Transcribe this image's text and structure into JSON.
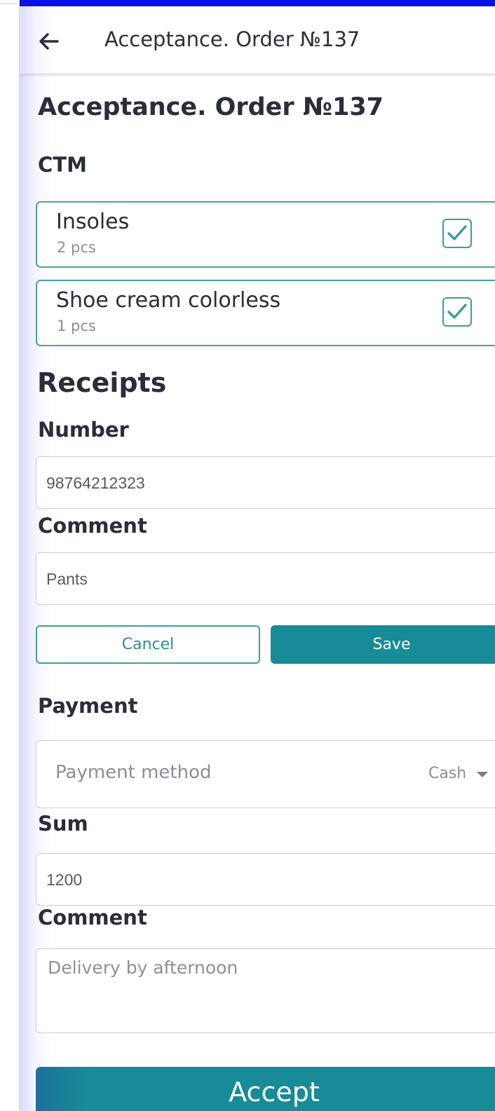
{
  "app_bar": {
    "title": "Acceptance. Order №137"
  },
  "page": {
    "title": "Acceptance. Order №137"
  },
  "ctm": {
    "section_title": "CTM",
    "items": [
      {
        "name": "Insoles",
        "quantity": "2 pcs",
        "checked": true
      },
      {
        "name": "Shoe cream colorless",
        "quantity": "1 pcs",
        "checked": true
      }
    ]
  },
  "receipts": {
    "title": "Receipts",
    "number_label": "Number",
    "number_value": "98764212323",
    "comment_label": "Comment",
    "comment_value": "Pants",
    "cancel_label": "Cancel",
    "save_label": "Save"
  },
  "payment": {
    "section_title": "Payment",
    "method_label": "Payment method",
    "method_value": "Cash",
    "sum_label": "Sum",
    "sum_value": "1200",
    "comment_label": "Comment",
    "comment_placeholder": "Delivery by afternoon"
  },
  "actions": {
    "accept_label": "Accept"
  },
  "colors": {
    "status_bar": "#0a10e8",
    "accent": "#178b98",
    "card_border": "#4aa0ad"
  },
  "icons": {
    "back": "arrow-left-icon",
    "checkbox": "checkmark-icon",
    "dropdown": "caret-down-icon"
  }
}
